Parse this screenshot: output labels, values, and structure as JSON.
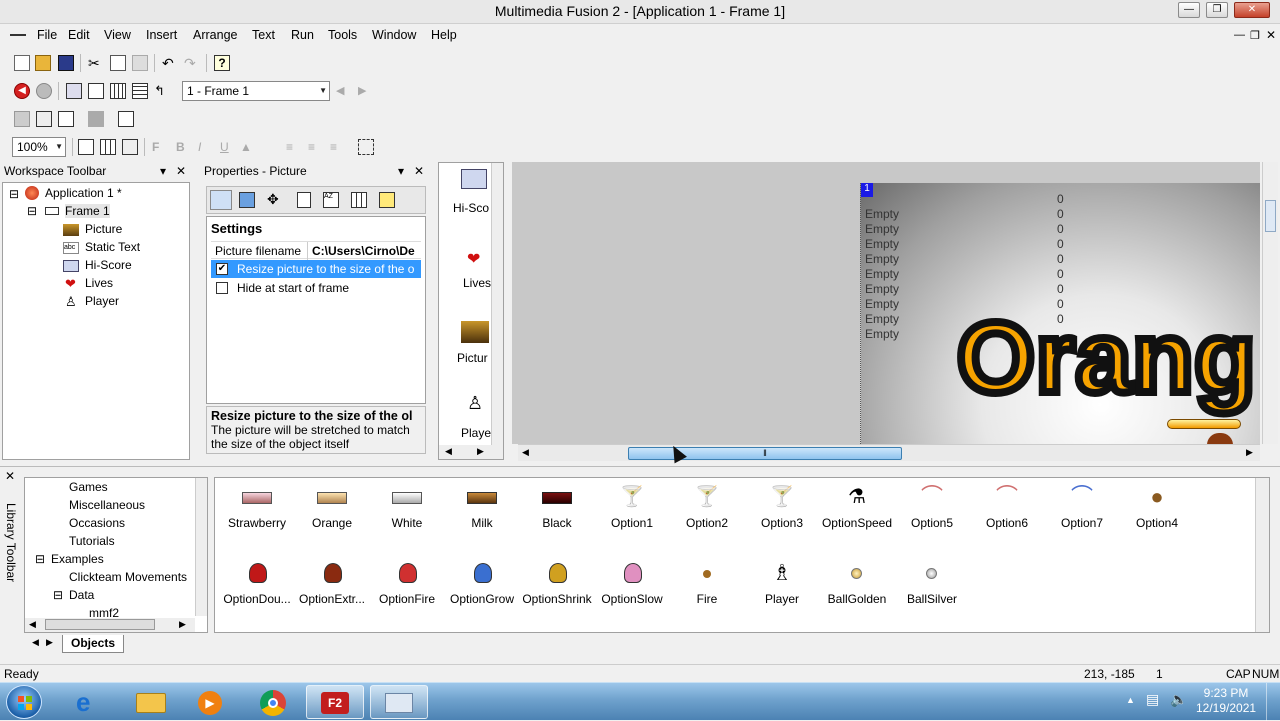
{
  "window": {
    "title": "Multimedia Fusion 2 - [Application 1 - Frame 1]"
  },
  "menu": [
    "File",
    "Edit",
    "View",
    "Insert",
    "Arrange",
    "Text",
    "Run",
    "Tools",
    "Window",
    "Help"
  ],
  "toolbar": {
    "frame_select": "1 - Frame 1",
    "zoom": "100%"
  },
  "workspace": {
    "title": "Workspace Toolbar",
    "app": "Application 1 *",
    "frame": "Frame 1",
    "objects": [
      {
        "label": "Picture",
        "icon": "picture-icon"
      },
      {
        "label": "Static Text",
        "icon": "static-text-icon"
      },
      {
        "label": "Hi-Score",
        "icon": "hi-score-icon"
      },
      {
        "label": "Lives",
        "icon": "heart-icon"
      },
      {
        "label": "Player",
        "icon": "player-icon"
      }
    ]
  },
  "properties": {
    "title": "Properties - Picture",
    "section": "Settings",
    "filename_label": "Picture filename",
    "filename_value": "C:\\Users\\Cirno\\De",
    "resize_label": "Resize picture to the size of the o",
    "resize_checked": true,
    "hide_label": "Hide at start of frame",
    "hide_checked": false,
    "help_title": "Resize picture to the size of the ol",
    "help_text": "The picture will be stretched to match the size of the object itself"
  },
  "object_strip": [
    {
      "label": "Hi-Sco",
      "icon": "hi-score-icon"
    },
    {
      "label": "Lives",
      "icon": "heart-icon"
    },
    {
      "label": "Pictur",
      "icon": "picture-icon"
    },
    {
      "label": "Playe",
      "icon": "player-icon"
    }
  ],
  "frame": {
    "marker": "1",
    "hiscore_rows": [
      "Empty",
      "Empty",
      "Empty",
      "Empty",
      "Empty",
      "Empty",
      "Empty",
      "Empty",
      "Empty"
    ],
    "hiscore_values": [
      "0",
      "0",
      "0",
      "0",
      "0",
      "0",
      "0",
      "0",
      "0"
    ],
    "big_text": "Orang"
  },
  "library": {
    "title": "Library Toolbar",
    "tab": "Objects",
    "tree": [
      {
        "label": "Games",
        "indent": 2
      },
      {
        "label": "Miscellaneous",
        "indent": 2
      },
      {
        "label": "Occasions",
        "indent": 2
      },
      {
        "label": "Tutorials",
        "indent": 2
      },
      {
        "label": "Examples",
        "indent": 1
      },
      {
        "label": "Clickteam Movements",
        "indent": 2
      },
      {
        "label": "Data",
        "indent": 1
      },
      {
        "label": "mmf2",
        "indent": 3
      }
    ],
    "items_row1": [
      "Strawberry",
      "Orange",
      "White",
      "Milk",
      "Black",
      "Option1",
      "Option2",
      "Option3",
      "OptionSpeed",
      "Option5",
      "Option6",
      "Option7",
      "Option4"
    ],
    "items_row2": [
      "OptionDou...",
      "OptionExtr...",
      "OptionFire",
      "OptionGrow",
      "OptionShrink",
      "OptionSlow",
      "Fire",
      "Player",
      "BallGolden",
      "BallSilver"
    ]
  },
  "status": {
    "text": "Ready",
    "coords": "213, -185",
    "layer": "1",
    "cap": "CAP",
    "num": "NUM"
  },
  "taskbar": {
    "time": "9:23 PM",
    "date": "12/19/2021",
    "apps": [
      "ie-icon",
      "explorer-icon",
      "media-player-icon",
      "chrome-icon",
      "fusion-icon",
      "control-panel-icon"
    ]
  }
}
